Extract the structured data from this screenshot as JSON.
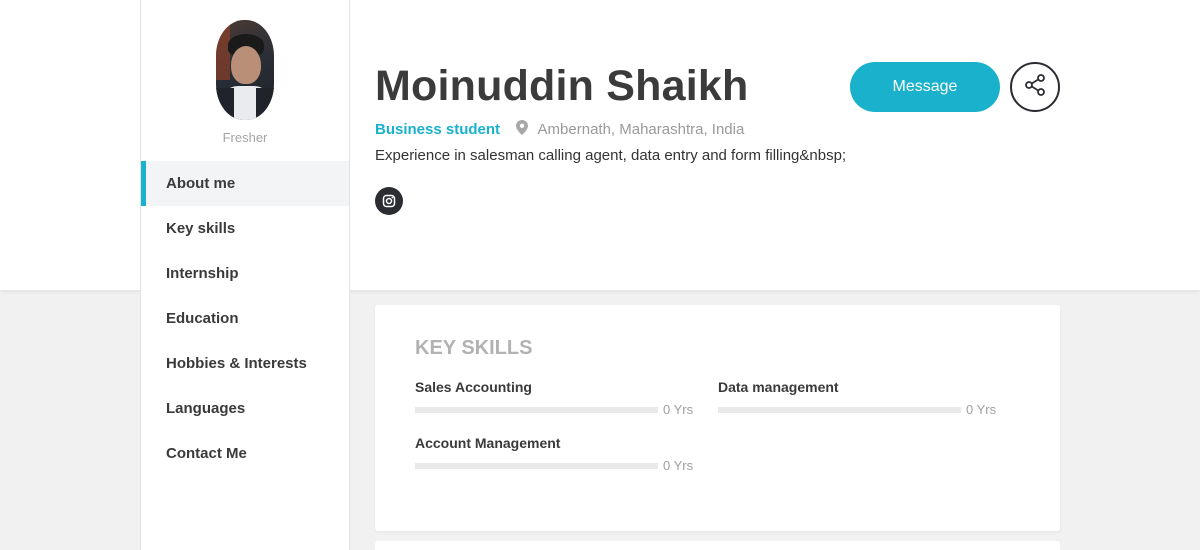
{
  "profile": {
    "name": "Moinuddin Shaikh",
    "status": "Fresher",
    "role": "Business student",
    "location": "Ambernath, Maharashtra, India",
    "bio": "Experience in salesman calling agent, data entry and form filling&nbsp;"
  },
  "actions": {
    "message_label": "Message",
    "share_icon": "share-icon",
    "instagram_icon": "instagram-icon"
  },
  "sidebar": {
    "items": [
      {
        "label": "About me",
        "active": true
      },
      {
        "label": "Key skills",
        "active": false
      },
      {
        "label": "Internship",
        "active": false
      },
      {
        "label": "Education",
        "active": false
      },
      {
        "label": "Hobbies & Interests",
        "active": false
      },
      {
        "label": "Languages",
        "active": false
      },
      {
        "label": "Contact Me",
        "active": false
      }
    ]
  },
  "key_skills": {
    "title": "KEY SKILLS",
    "skills": [
      {
        "name": "Sales Accounting",
        "years": "0 Yrs",
        "level": 0
      },
      {
        "name": "Data management",
        "years": "0 Yrs",
        "level": 0
      },
      {
        "name": "Account Management",
        "years": "0 Yrs",
        "level": 0
      }
    ]
  },
  "colors": {
    "accent": "#1ab1cc",
    "dark": "#2b2d33",
    "muted": "#a4a4a4"
  }
}
